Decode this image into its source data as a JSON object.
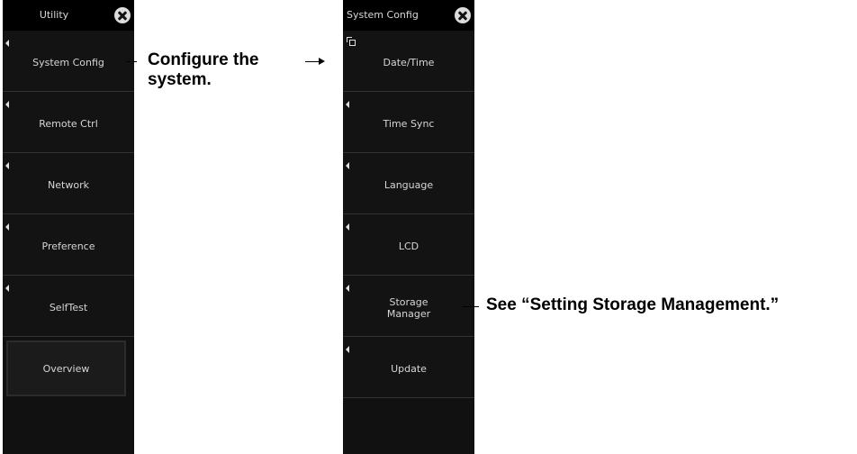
{
  "left_panel": {
    "title": "Utility",
    "items": [
      {
        "label": "System Config"
      },
      {
        "label": "Remote Ctrl"
      },
      {
        "label": "Network"
      },
      {
        "label": "Preference"
      },
      {
        "label": "SelfTest"
      },
      {
        "label": "Overview"
      }
    ]
  },
  "right_panel": {
    "title": "System Config",
    "items": [
      {
        "label": "Date/Time"
      },
      {
        "label": "Time Sync"
      },
      {
        "label": "Language"
      },
      {
        "label": "LCD"
      },
      {
        "label_line1": "Storage",
        "label_line2": "Manager"
      },
      {
        "label": "Update"
      }
    ]
  },
  "annotations": {
    "configure_line1": "Configure the",
    "configure_line2": "system.",
    "storage_note": "See “Setting Storage Management.”"
  },
  "icons": {
    "close": "close-icon",
    "submenu": "submenu-icon",
    "expand": "left-triangle-icon"
  },
  "colors": {
    "panel_bg": "#111111",
    "header_bg": "#000000",
    "text": "#d6d6d6",
    "divider": "#333333"
  }
}
